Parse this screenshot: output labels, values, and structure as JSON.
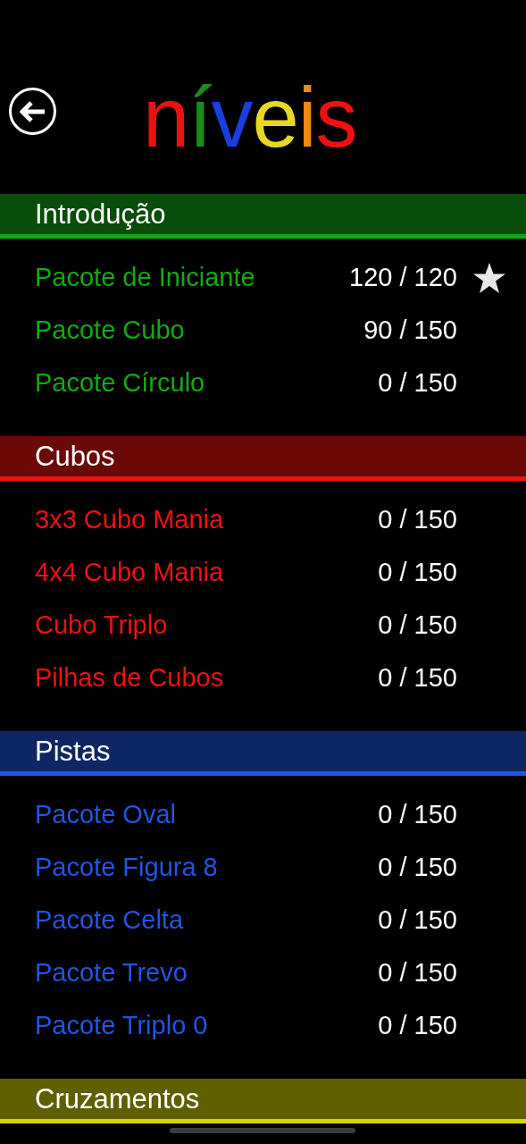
{
  "title_letters": [
    {
      "text": "n",
      "color": "#ee1111"
    },
    {
      "text": "í",
      "color": "#1a8c1a"
    },
    {
      "text": "v",
      "color": "#1a3fe0"
    },
    {
      "text": "e",
      "color": "#e8d820"
    },
    {
      "text": "i",
      "color": "#f08a10"
    },
    {
      "text": "s",
      "color": "#ee1111"
    }
  ],
  "sections": [
    {
      "title": "Introdução",
      "color": "#11aa11",
      "items": [
        {
          "name": "Pacote de Iniciante",
          "progress": "120 / 120",
          "starred": true
        },
        {
          "name": "Pacote Cubo",
          "progress": "90 / 150",
          "starred": false
        },
        {
          "name": "Pacote Círculo",
          "progress": "0 / 150",
          "starred": false
        }
      ]
    },
    {
      "title": "Cubos",
      "color": "#ee1111",
      "items": [
        {
          "name": "3x3 Cubo Mania",
          "progress": "0 / 150",
          "starred": false
        },
        {
          "name": "4x4 Cubo Mania",
          "progress": "0 / 150",
          "starred": false
        },
        {
          "name": "Cubo Triplo",
          "progress": "0 / 150",
          "starred": false
        },
        {
          "name": "Pilhas de Cubos",
          "progress": "0 / 150",
          "starred": false
        }
      ]
    },
    {
      "title": "Pistas",
      "color": "#2255e0",
      "items": [
        {
          "name": "Pacote Oval",
          "progress": "0 / 150",
          "starred": false
        },
        {
          "name": "Pacote Figura 8",
          "progress": "0 / 150",
          "starred": false
        },
        {
          "name": "Pacote Celta",
          "progress": "0 / 150",
          "starred": false
        },
        {
          "name": "Pacote Trevo",
          "progress": "0 / 150",
          "starred": false
        },
        {
          "name": "Pacote Triplo 0",
          "progress": "0 / 150",
          "starred": false
        }
      ]
    },
    {
      "title": "Cruzamentos",
      "color": "#d4d400"
    }
  ]
}
